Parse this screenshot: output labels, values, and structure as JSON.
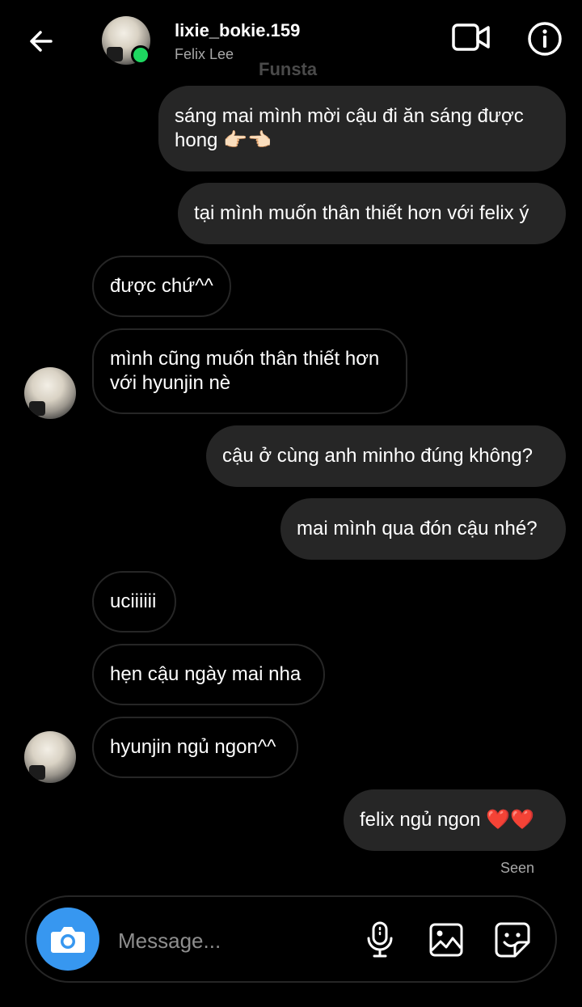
{
  "header": {
    "username": "lixie_bokie.159",
    "display_name": "Felix Lee",
    "overlay_label": "Funsta"
  },
  "messages": [
    {
      "side": "out",
      "text": "sáng mai mình mời cậu đi ăn sáng được hong 👉🏻👈🏻"
    },
    {
      "side": "out",
      "text": "tại mình muốn thân thiết hơn với felix ý"
    },
    {
      "side": "in",
      "text": "được chứ^^"
    },
    {
      "side": "in",
      "text": "mình cũng muốn thân thiết hơn với hyunjin nè"
    },
    {
      "side": "out",
      "text": "cậu ở cùng anh minho đúng không?"
    },
    {
      "side": "out",
      "text": "mai mình qua đón cậu nhé?"
    },
    {
      "side": "in",
      "text": "uciiiiii"
    },
    {
      "side": "in",
      "text": "hẹn cậu ngày mai nha"
    },
    {
      "side": "in",
      "text": "hyunjin ngủ ngon^^"
    },
    {
      "side": "out",
      "text": "felix ngủ ngon ❤️❤️"
    }
  ],
  "seen_label": "Seen",
  "composer": {
    "placeholder": "Message..."
  },
  "colors": {
    "background": "#000000",
    "outgoing_bubble": "#262626",
    "camera_button": "#3797f0",
    "online_dot": "#1ed760",
    "secondary_text": "#a8a8a8"
  }
}
